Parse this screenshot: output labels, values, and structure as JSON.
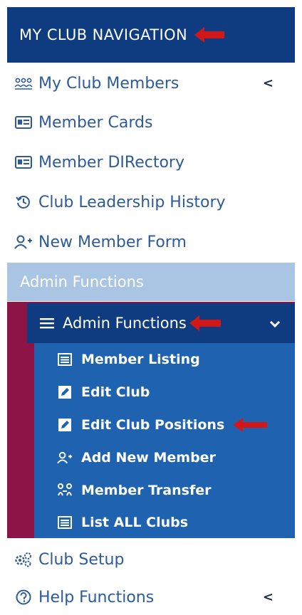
{
  "header": {
    "title": "MY CLUB NAVIGATION"
  },
  "menu": [
    {
      "label": "My Club Members",
      "icon": "members-group-icon",
      "chevron": "<"
    },
    {
      "label": "Member Cards",
      "icon": "id-card-icon"
    },
    {
      "label": "Member DIRectory",
      "icon": "id-card-icon"
    },
    {
      "label": "Club Leadership History",
      "icon": "history-icon"
    },
    {
      "label": "New Member Form",
      "icon": "user-add-icon"
    }
  ],
  "admin_section": {
    "label": "Admin Functions",
    "submenu_title": "Admin Functions",
    "items": [
      {
        "label": "Member Listing",
        "icon": "list-icon"
      },
      {
        "label": "Edit Club",
        "icon": "edit-icon"
      },
      {
        "label": "Edit Club Positions",
        "icon": "edit-icon"
      },
      {
        "label": "Add New Member",
        "icon": "user-add-icon"
      },
      {
        "label": "Member Transfer",
        "icon": "transfer-icon"
      },
      {
        "label": "List ALL Clubs",
        "icon": "list-icon"
      }
    ]
  },
  "bottom": [
    {
      "label": "Club Setup",
      "icon": "gears-icon"
    },
    {
      "label": "Help Functions",
      "icon": "help-icon",
      "chevron": "<"
    }
  ],
  "colors": {
    "header_bg": "#0f3c80",
    "link": "#2d5b97",
    "admin_bar": "#a9c5e3",
    "admin_frame": "#8d1446",
    "submenu_bg": "#1f63b0",
    "annotation_arrow": "#d01818"
  }
}
